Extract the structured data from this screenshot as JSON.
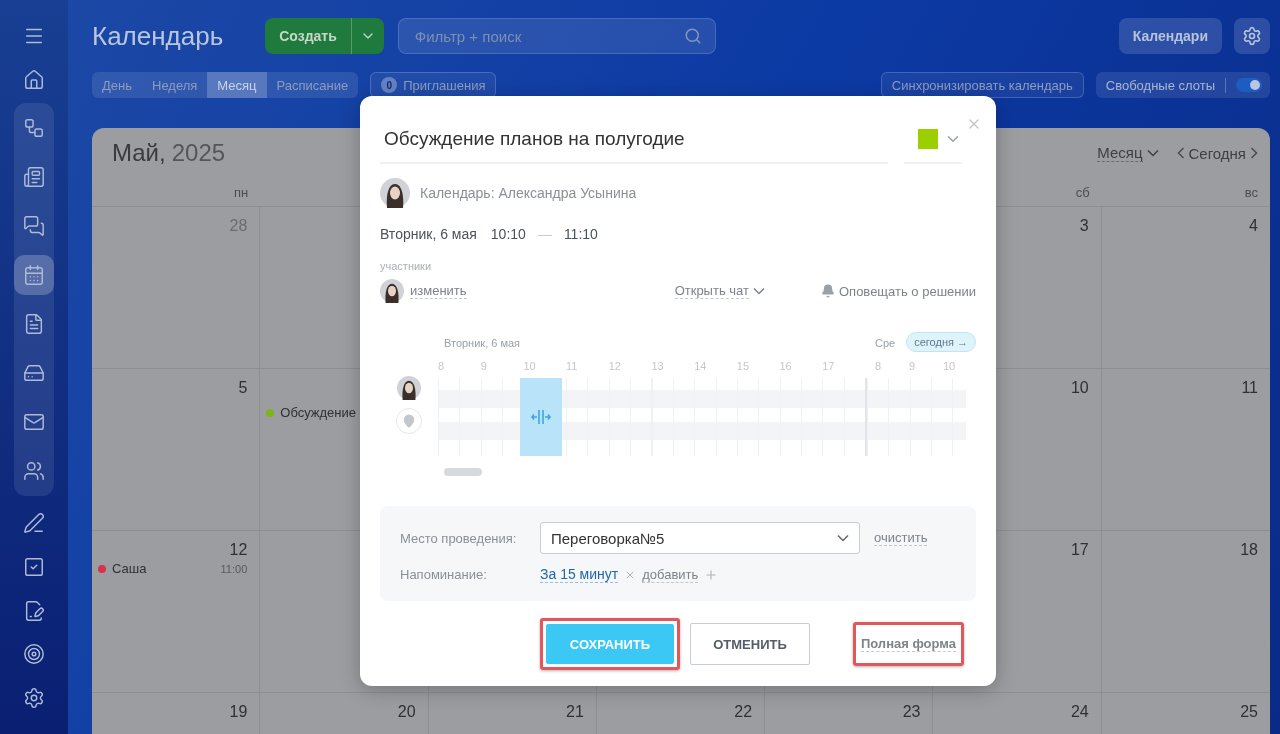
{
  "sidebar": {
    "top_items": [
      {
        "kind": "menu",
        "selected": false
      },
      {
        "kind": "home",
        "selected": false
      }
    ],
    "group_items": [
      {
        "kind": "flow",
        "selected": false
      },
      {
        "kind": "feed",
        "selected": false
      },
      {
        "kind": "chat",
        "selected": false
      },
      {
        "kind": "calendar",
        "selected": true
      },
      {
        "kind": "document",
        "selected": false
      },
      {
        "kind": "drive",
        "selected": false
      },
      {
        "kind": "mail",
        "selected": false
      },
      {
        "kind": "people",
        "selected": false
      }
    ],
    "bottom_items": [
      {
        "kind": "sign",
        "selected": false
      },
      {
        "kind": "tasks",
        "selected": false
      },
      {
        "kind": "edit-doc",
        "selected": false
      },
      {
        "kind": "target",
        "selected": false
      }
    ],
    "footer_items": [
      {
        "kind": "settings",
        "selected": false
      }
    ]
  },
  "header": {
    "title": "Календарь",
    "create_button": "Создать",
    "search": {
      "placeholder": "Фильтр + поиск"
    },
    "calendars_button": "Календари"
  },
  "view_tabs": [
    {
      "label": "День",
      "selected": false
    },
    {
      "label": "Неделя",
      "selected": false
    },
    {
      "label": "Месяц",
      "selected": true
    },
    {
      "label": "Расписание",
      "selected": false
    }
  ],
  "invitations": {
    "label": "Приглашения",
    "count": "0"
  },
  "sync_button": "Синхронизировать календарь",
  "free_slots": {
    "label": "Свободные слоты",
    "on": true
  },
  "calendar": {
    "month": "Май,",
    "year": "2025",
    "view_select": "Месяц",
    "today_button": "Сегодня",
    "weekdays": {
      "mon": "пн",
      "sat": "сб",
      "sun": "вс"
    },
    "weeks": [
      {
        "mon": {
          "day": "28",
          "muted": true
        },
        "sat": {
          "day": "3",
          "muted": false
        },
        "sun": {
          "day": "4",
          "muted": false
        }
      },
      {
        "mon": {
          "day": "5",
          "muted": false
        },
        "tue": {
          "events": [
            {
              "title": "Обсуждение",
              "color": "#7cb518"
            }
          ]
        },
        "sat": {
          "day": "10",
          "muted": false
        },
        "sun": {
          "day": "11",
          "muted": false
        }
      },
      {
        "mon": {
          "day": "12",
          "muted": false,
          "events": [
            {
              "title": "Саша",
              "time": "11:00",
              "color": "#d9304e"
            }
          ]
        },
        "sat": {
          "day": "17",
          "muted": false
        },
        "sun": {
          "day": "18",
          "muted": false
        }
      },
      {
        "mon": {
          "day": "19",
          "muted": false
        },
        "tue": {
          "day": "20",
          "muted": false
        },
        "wed": {
          "day": "21",
          "muted": false
        },
        "thu": {
          "day": "22",
          "muted": false
        },
        "fri": {
          "day": "23",
          "muted": false
        },
        "sat": {
          "day": "24",
          "muted": false
        },
        "sun": {
          "day": "25",
          "muted": false
        }
      }
    ]
  },
  "modal": {
    "title": "Обсуждение планов на полугодие",
    "color": "#9dcf00",
    "calendar_owner": "Календарь: Александра Усынина",
    "date": "Вторник, 6 мая",
    "time_from": "10:10",
    "time_separator": "—",
    "time_to": "11:10",
    "participants_label": "участники",
    "change_link": "изменить",
    "open_chat": "Открыть чат",
    "notify": "Оповещать о решении",
    "planner": {
      "day_label": "Вторник, 6 мая",
      "next_day_label": "Сре",
      "today_chip": "сегодня →",
      "hours": [
        "8",
        "9",
        "10",
        "11",
        "12",
        "13",
        "14",
        "15",
        "16",
        "17"
      ],
      "next_hours": [
        "8",
        "9",
        "10"
      ]
    },
    "location": {
      "label": "Место проведения:",
      "value": "Переговорка№5",
      "clear": "очистить"
    },
    "reminder": {
      "label": "Напоминание:",
      "value": "За 15 минут",
      "add": "добавить"
    },
    "buttons": [
      {
        "kind": "primary",
        "label": "СОХРАНИТЬ",
        "highlighted": true
      },
      {
        "kind": "secondary",
        "label": "ОТМЕНИТЬ",
        "highlighted": false
      },
      {
        "kind": "link",
        "label": "Полная форма",
        "highlighted": true
      }
    ]
  }
}
